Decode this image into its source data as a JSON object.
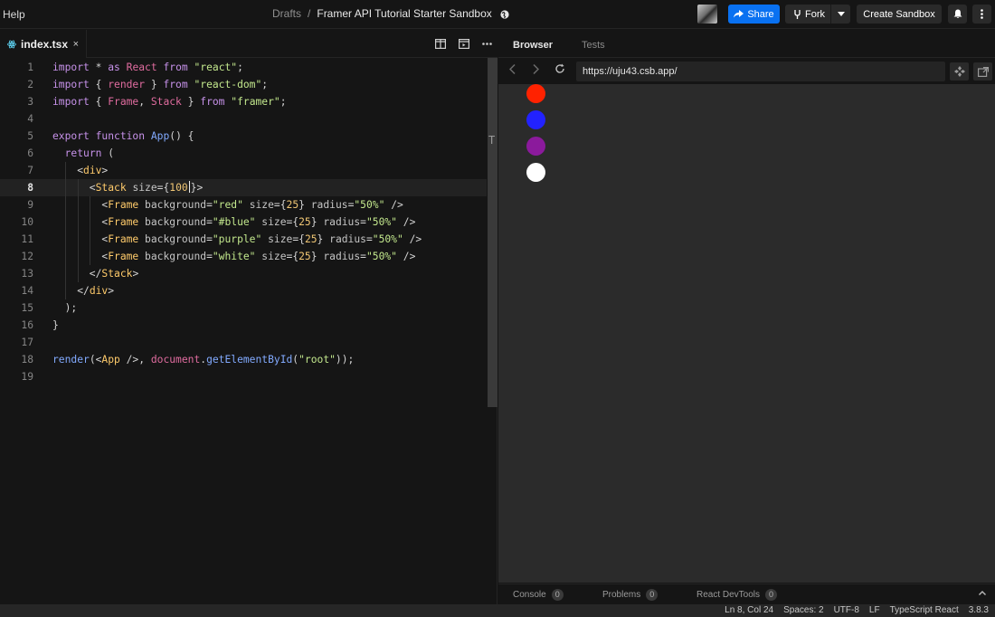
{
  "topbar": {
    "help": "Help",
    "breadcrumb_parent": "Drafts",
    "breadcrumb_sep": "/",
    "sandbox_title": "Framer API Tutorial Starter Sandbox",
    "share_label": "Share",
    "fork_label": "Fork",
    "create_label": "Create Sandbox",
    "icons": [
      "globe-icon",
      "share-arrow-icon",
      "fork-icon",
      "caret-down-icon",
      "bell-icon",
      "more-vertical-icon"
    ],
    "accent": "#0971f1"
  },
  "editor": {
    "tab_label": "index.tsx",
    "tab_close": "×",
    "active_line": 8,
    "line_numbers": [
      "1",
      "2",
      "3",
      "4",
      "5",
      "6",
      "7",
      "8",
      "9",
      "10",
      "11",
      "12",
      "13",
      "14",
      "15",
      "16",
      "17",
      "18",
      "19"
    ],
    "lines": [
      [
        [
          "kw",
          "import"
        ],
        [
          "pun",
          " * "
        ],
        [
          "kw",
          "as"
        ],
        [
          "pun",
          " "
        ],
        [
          "id",
          "React"
        ],
        [
          "pun",
          " "
        ],
        [
          "kw",
          "from"
        ],
        [
          "pun",
          " "
        ],
        [
          "str",
          "\"react\""
        ],
        [
          "pun",
          ";"
        ]
      ],
      [
        [
          "kw",
          "import"
        ],
        [
          "pun",
          " { "
        ],
        [
          "id",
          "render"
        ],
        [
          "pun",
          " } "
        ],
        [
          "kw",
          "from"
        ],
        [
          "pun",
          " "
        ],
        [
          "str",
          "\"react-dom\""
        ],
        [
          "pun",
          ";"
        ]
      ],
      [
        [
          "kw",
          "import"
        ],
        [
          "pun",
          " { "
        ],
        [
          "id",
          "Frame"
        ],
        [
          "pun",
          ", "
        ],
        [
          "id",
          "Stack"
        ],
        [
          "pun",
          " } "
        ],
        [
          "kw",
          "from"
        ],
        [
          "pun",
          " "
        ],
        [
          "str",
          "\"framer\""
        ],
        [
          "pun",
          ";"
        ]
      ],
      [],
      [
        [
          "kw",
          "export"
        ],
        [
          "pun",
          " "
        ],
        [
          "kw",
          "function"
        ],
        [
          "pun",
          " "
        ],
        [
          "fn",
          "App"
        ],
        [
          "pun",
          "() {"
        ]
      ],
      [
        [
          "pun",
          "  "
        ],
        [
          "kw",
          "return"
        ],
        [
          "pun",
          " ("
        ]
      ],
      [
        [
          "pun",
          "    <"
        ],
        [
          "tag",
          "div"
        ],
        [
          "pun",
          ">"
        ]
      ],
      [
        [
          "pun",
          "      <"
        ],
        [
          "tag",
          "Stack"
        ],
        [
          "pun",
          " "
        ],
        [
          "attr",
          "size"
        ],
        [
          "pun",
          "={"
        ],
        [
          "num",
          "100"
        ],
        [
          "caret",
          ""
        ],
        [
          "pun",
          "}>"
        ]
      ],
      [
        [
          "pun",
          "        <"
        ],
        [
          "tag",
          "Frame"
        ],
        [
          "pun",
          " "
        ],
        [
          "attr",
          "background"
        ],
        [
          "pun",
          "="
        ],
        [
          "str",
          "\"red\""
        ],
        [
          "pun",
          " "
        ],
        [
          "attr",
          "size"
        ],
        [
          "pun",
          "={"
        ],
        [
          "num",
          "25"
        ],
        [
          "pun",
          "} "
        ],
        [
          "attr",
          "radius"
        ],
        [
          "pun",
          "="
        ],
        [
          "str",
          "\"50%\""
        ],
        [
          "pun",
          " />"
        ]
      ],
      [
        [
          "pun",
          "        <"
        ],
        [
          "tag",
          "Frame"
        ],
        [
          "pun",
          " "
        ],
        [
          "attr",
          "background"
        ],
        [
          "pun",
          "="
        ],
        [
          "str",
          "\"#blue\""
        ],
        [
          "pun",
          " "
        ],
        [
          "attr",
          "size"
        ],
        [
          "pun",
          "={"
        ],
        [
          "num",
          "25"
        ],
        [
          "pun",
          "} "
        ],
        [
          "attr",
          "radius"
        ],
        [
          "pun",
          "="
        ],
        [
          "str",
          "\"50%\""
        ],
        [
          "pun",
          " />"
        ]
      ],
      [
        [
          "pun",
          "        <"
        ],
        [
          "tag",
          "Frame"
        ],
        [
          "pun",
          " "
        ],
        [
          "attr",
          "background"
        ],
        [
          "pun",
          "="
        ],
        [
          "str",
          "\"purple\""
        ],
        [
          "pun",
          " "
        ],
        [
          "attr",
          "size"
        ],
        [
          "pun",
          "={"
        ],
        [
          "num",
          "25"
        ],
        [
          "pun",
          "} "
        ],
        [
          "attr",
          "radius"
        ],
        [
          "pun",
          "="
        ],
        [
          "str",
          "\"50%\""
        ],
        [
          "pun",
          " />"
        ]
      ],
      [
        [
          "pun",
          "        <"
        ],
        [
          "tag",
          "Frame"
        ],
        [
          "pun",
          " "
        ],
        [
          "attr",
          "background"
        ],
        [
          "pun",
          "="
        ],
        [
          "str",
          "\"white\""
        ],
        [
          "pun",
          " "
        ],
        [
          "attr",
          "size"
        ],
        [
          "pun",
          "={"
        ],
        [
          "num",
          "25"
        ],
        [
          "pun",
          "} "
        ],
        [
          "attr",
          "radius"
        ],
        [
          "pun",
          "="
        ],
        [
          "str",
          "\"50%\""
        ],
        [
          "pun",
          " />"
        ]
      ],
      [
        [
          "pun",
          "      </"
        ],
        [
          "tag",
          "Stack"
        ],
        [
          "pun",
          ">"
        ]
      ],
      [
        [
          "pun",
          "    </"
        ],
        [
          "tag",
          "div"
        ],
        [
          "pun",
          ">"
        ]
      ],
      [
        [
          "pun",
          "  );"
        ]
      ],
      [
        [
          "pun",
          "}"
        ]
      ],
      [],
      [
        [
          "fn",
          "render"
        ],
        [
          "pun",
          "(<"
        ],
        [
          "tag",
          "App"
        ],
        [
          "pun",
          " />, "
        ],
        [
          "id",
          "document"
        ],
        [
          "pun",
          "."
        ],
        [
          "fn",
          "getElementById"
        ],
        [
          "pun",
          "("
        ],
        [
          "str",
          "\"root\""
        ],
        [
          "pun",
          "));"
        ]
      ],
      []
    ],
    "scroll_marker": "T"
  },
  "pane": {
    "browser_tab": "Browser",
    "tests_tab": "Tests",
    "url": "https://uju43.csb.app/",
    "preview_dots": [
      {
        "color": "#ff2200"
      },
      {
        "color": "#2222ff"
      },
      {
        "color": "#8b1a9c"
      },
      {
        "color": "#ffffff"
      }
    ],
    "console_items": [
      {
        "label": "Console",
        "count": "0"
      },
      {
        "label": "Problems",
        "count": "0"
      },
      {
        "label": "React DevTools",
        "count": "0"
      }
    ]
  },
  "statusbar": {
    "position": "Ln 8, Col 24",
    "spaces": "Spaces: 2",
    "encoding": "UTF-8",
    "eol": "LF",
    "language": "TypeScript React",
    "version": "3.8.3"
  }
}
